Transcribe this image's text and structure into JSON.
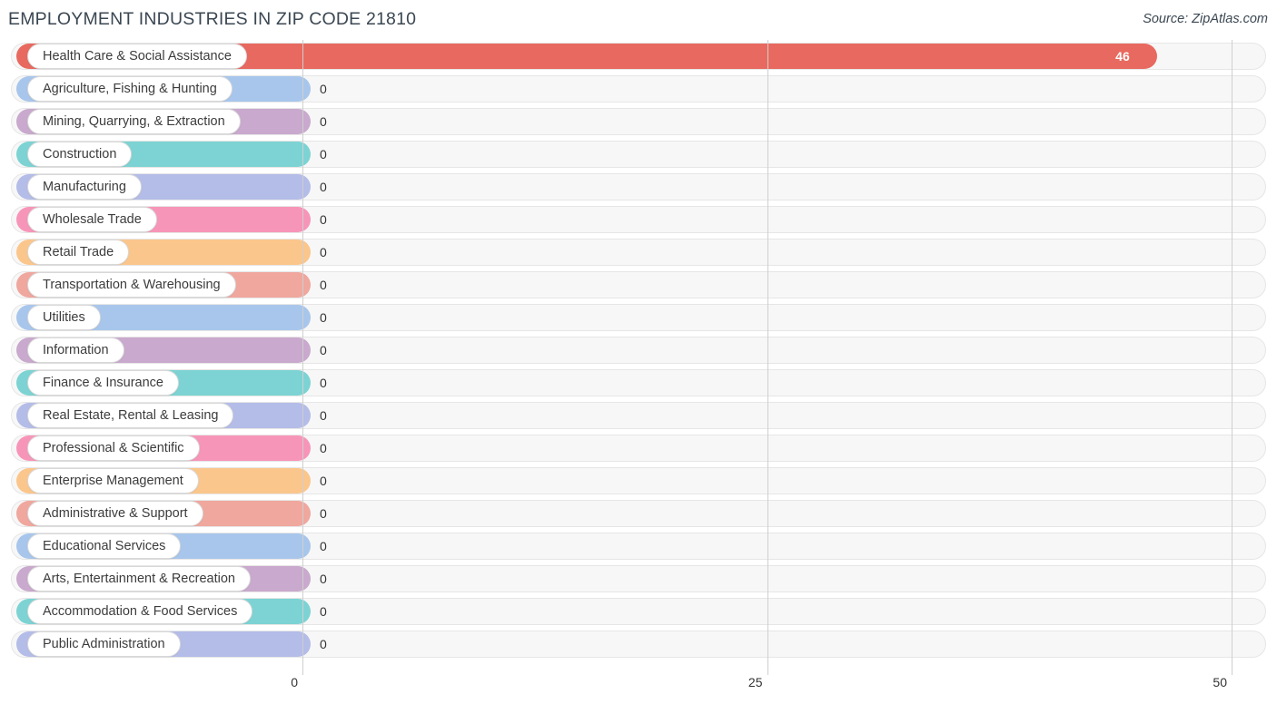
{
  "header": {
    "title": "EMPLOYMENT INDUSTRIES IN ZIP CODE 21810",
    "source": "Source: ZipAtlas.com"
  },
  "chart_data": {
    "type": "bar",
    "orientation": "horizontal",
    "title": "EMPLOYMENT INDUSTRIES IN ZIP CODE 21810",
    "xlabel": "",
    "ylabel": "",
    "xlim": [
      0,
      50
    ],
    "ticks": [
      "0",
      "25",
      "50"
    ],
    "tick_values": [
      0,
      25,
      50
    ],
    "grid": true,
    "legend": "none",
    "categories": [
      "Health Care & Social Assistance",
      "Agriculture, Fishing & Hunting",
      "Mining, Quarrying, & Extraction",
      "Construction",
      "Manufacturing",
      "Wholesale Trade",
      "Retail Trade",
      "Transportation & Warehousing",
      "Utilities",
      "Information",
      "Finance & Insurance",
      "Real Estate, Rental & Leasing",
      "Professional & Scientific",
      "Enterprise Management",
      "Administrative & Support",
      "Educational Services",
      "Arts, Entertainment & Recreation",
      "Accommodation & Food Services",
      "Public Administration"
    ],
    "values": [
      46,
      0,
      0,
      0,
      0,
      0,
      0,
      0,
      0,
      0,
      0,
      0,
      0,
      0,
      0,
      0,
      0,
      0,
      0
    ],
    "value_labels": [
      "46",
      "0",
      "0",
      "0",
      "0",
      "0",
      "0",
      "0",
      "0",
      "0",
      "0",
      "0",
      "0",
      "0",
      "0",
      "0",
      "0",
      "0",
      "0"
    ],
    "colors": [
      "#e8695f",
      "#a8c6ec",
      "#c9a9cd",
      "#7dd3d3",
      "#b4bce8",
      "#f795b8",
      "#fbc68c",
      "#efa79e",
      "#a8c6ec",
      "#c9a9cd",
      "#7dd3d3",
      "#b4bce8",
      "#f795b8",
      "#fbc68c",
      "#efa79e",
      "#a8c6ec",
      "#c9a9cd",
      "#7dd3d3",
      "#b4bce8"
    ]
  }
}
